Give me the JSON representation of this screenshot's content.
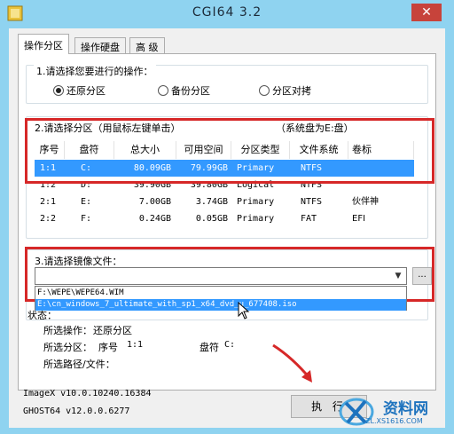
{
  "window": {
    "title": "CGI64  3.2",
    "close_label": "✕"
  },
  "tabs": [
    {
      "label": "操作分区",
      "active": true
    },
    {
      "label": "操作硬盘",
      "active": false
    },
    {
      "label": "高 级",
      "active": false
    }
  ],
  "operation": {
    "title": "1.请选择您要进行的操作：",
    "options": [
      {
        "label": "还原分区",
        "selected": true
      },
      {
        "label": "备份分区",
        "selected": false
      },
      {
        "label": "分区对拷",
        "selected": false
      }
    ]
  },
  "partition": {
    "title": "2.请选择分区（用鼠标左键单击）",
    "system_note": "（系统盘为E:盘）",
    "columns": [
      "序号",
      "盘符",
      "总大小",
      "可用空间",
      "分区类型",
      "文件系统",
      "卷标"
    ],
    "rows": [
      [
        "1:1",
        "C:",
        "80.09GB",
        "79.99GB",
        "Primary",
        "NTFS",
        ""
      ],
      [
        "1:2",
        "D:",
        "39.90GB",
        "39.80GB",
        "Logical",
        "NTFS",
        ""
      ],
      [
        "2:1",
        "E:",
        "7.00GB",
        "3.74GB",
        "Primary",
        "NTFS",
        "伙伴神"
      ],
      [
        "2:2",
        "F:",
        "0.24GB",
        "0.05GB",
        "Primary",
        "FAT",
        "EFI"
      ]
    ],
    "selected_row": 0
  },
  "image": {
    "title": "3.请选择镜像文件：",
    "combo_value": "",
    "browse_label": "...",
    "dropdown_items": [
      "F:\\WEPE\\WEPE64.WIM",
      "E:\\cn_windows_7_ultimate_with_sp1_x64_dvd_u_677408.iso"
    ],
    "highlighted_item": 1
  },
  "status": {
    "title": "状态：",
    "operation_label": "所选操作：",
    "operation_value": "还原分区",
    "partition_label": "所选分区：",
    "index_label": "序号",
    "index_value": "1:1",
    "drive_label": "盘符",
    "drive_value": "C:",
    "path_label": "所选路径/文件："
  },
  "footer": {
    "imagex_version": "ImageX v10.0.10240.16384",
    "ghost_version": "GHOST64 v12.0.0.6277",
    "execute_label": "执 行"
  },
  "watermark": {
    "brand": "资料网",
    "url": "ZL.XS1616.COM"
  },
  "colors": {
    "titlebar": "#8fd3f0",
    "selection": "#3399ff",
    "annotation_red": "#d62828"
  }
}
